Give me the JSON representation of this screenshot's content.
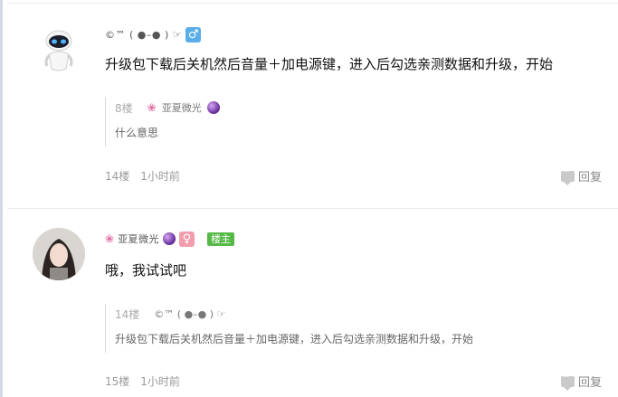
{
  "posts": [
    {
      "author": "©™ ( ●–● ) ☞",
      "gender_symbol": "♂",
      "content": "升级包下载后关机然后音量＋加电源键，进入后勾选亲测数据和升级，开始",
      "quote": {
        "floor": "8楼",
        "author_name": "亚夏微光",
        "text": "什么意思"
      },
      "floor": "14楼",
      "time": "1小时前",
      "reply_label": "回复"
    },
    {
      "author": "亚夏微光",
      "gender_symbol": "♀",
      "owner_tag": "楼主",
      "content": "哦，我试试吧",
      "quote": {
        "floor": "14楼",
        "author_name": "©™ ( ●–● ) ☞",
        "text": "升级包下载后关机然后音量＋加电源键，进入后勾选亲测数据和升级，开始"
      },
      "floor": "15楼",
      "time": "1小时前",
      "reply_label": "回复"
    }
  ],
  "icons": {
    "avatar_1": "robot-avatar",
    "avatar_2": "girl-photo-avatar",
    "reply": "comment-bubble-icon",
    "flower": "flower-icon",
    "orb": "crystal-ball-icon"
  },
  "colors": {
    "male_badge": "#5aaee8",
    "female_badge": "#f39cae",
    "owner_tag": "#55b847"
  }
}
